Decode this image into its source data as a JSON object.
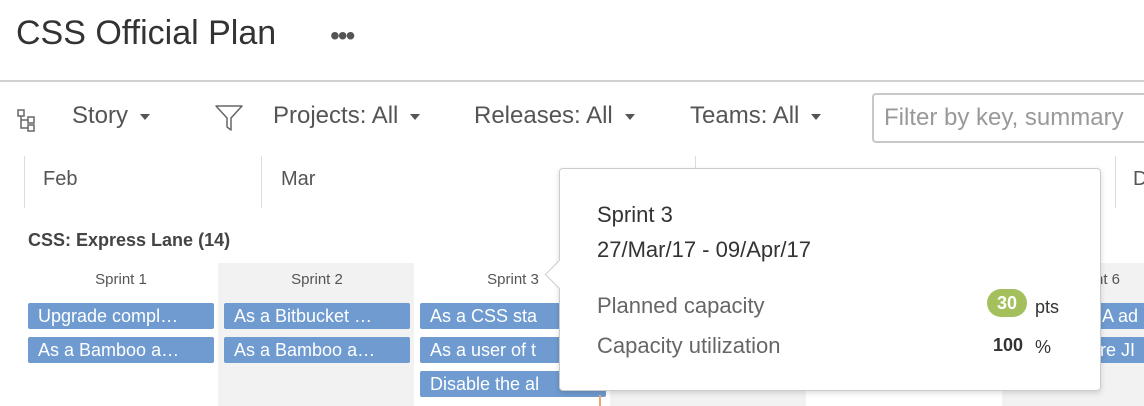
{
  "header": {
    "title": "CSS Official Plan",
    "more_label": "•••"
  },
  "toolbar": {
    "hierarchy": "Story",
    "projects": "Projects: All",
    "releases": "Releases: All",
    "teams": "Teams: All",
    "search_placeholder": "Filter by key, summary"
  },
  "timeline": {
    "months": [
      "Feb",
      "Mar",
      "",
      "D"
    ]
  },
  "lane": {
    "title": "CSS: Express Lane (14)"
  },
  "sprints": [
    {
      "label": "Sprint 1",
      "cards": [
        "Upgrade compl…",
        "As a Bamboo a…"
      ]
    },
    {
      "label": "Sprint 2",
      "cards": [
        "As a Bitbucket …",
        "As a Bamboo a…"
      ]
    },
    {
      "label": "Sprint 3",
      "cards": [
        "As a CSS sta",
        "As a user of t",
        "Disable the al"
      ]
    },
    {
      "label": "nt 6",
      "cards": [
        "A ad",
        "re JI"
      ]
    }
  ],
  "tooltip": {
    "title": "Sprint 3",
    "dates": "27/Mar/17 - 09/Apr/17",
    "planned_label": "Planned capacity",
    "planned_value": "30",
    "planned_unit": "pts",
    "util_label": "Capacity utilization",
    "util_value": "100",
    "util_unit": "%"
  },
  "colors": {
    "card": "#6f9bd0",
    "badge": "#a3c05c",
    "sprint_alt_bg": "#f2f2f2"
  }
}
